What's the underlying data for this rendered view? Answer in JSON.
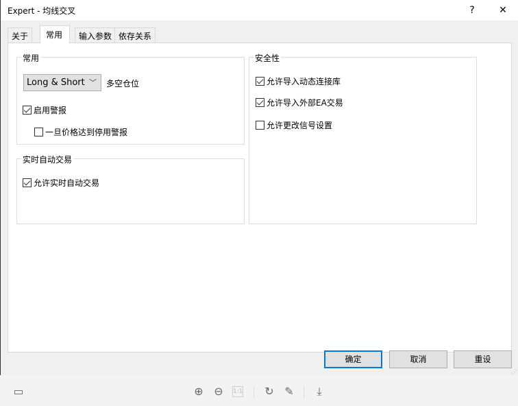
{
  "window": {
    "title": "Expert - 均线交叉",
    "help": "?",
    "close": "✕"
  },
  "tabs": [
    {
      "label": "关于"
    },
    {
      "label": "常用",
      "active": true
    },
    {
      "label": "输入参数"
    },
    {
      "label": "依存关系"
    }
  ],
  "general": {
    "label": "常用",
    "position_select": "Long & Short",
    "position_label": "多空仓位",
    "enable_alerts": {
      "label": "启用警报",
      "checked": true
    },
    "disable_alert_on_price": {
      "label": "一旦价格达到停用警报",
      "checked": false
    }
  },
  "live": {
    "label": "实时自动交易",
    "allow_live": {
      "label": "允许实时自动交易",
      "checked": true
    }
  },
  "security": {
    "label": "安全性",
    "allow_dll": {
      "label": "允许导入动态连接库",
      "checked": true
    },
    "allow_external_ea": {
      "label": "允许导入外部EA交易",
      "checked": true
    },
    "allow_signal_change": {
      "label": "允许更改信号设置",
      "checked": false
    }
  },
  "buttons": {
    "ok": "确定",
    "cancel": "取消",
    "reset": "重设"
  },
  "toolbar": {
    "one_to_one": "1:1"
  }
}
